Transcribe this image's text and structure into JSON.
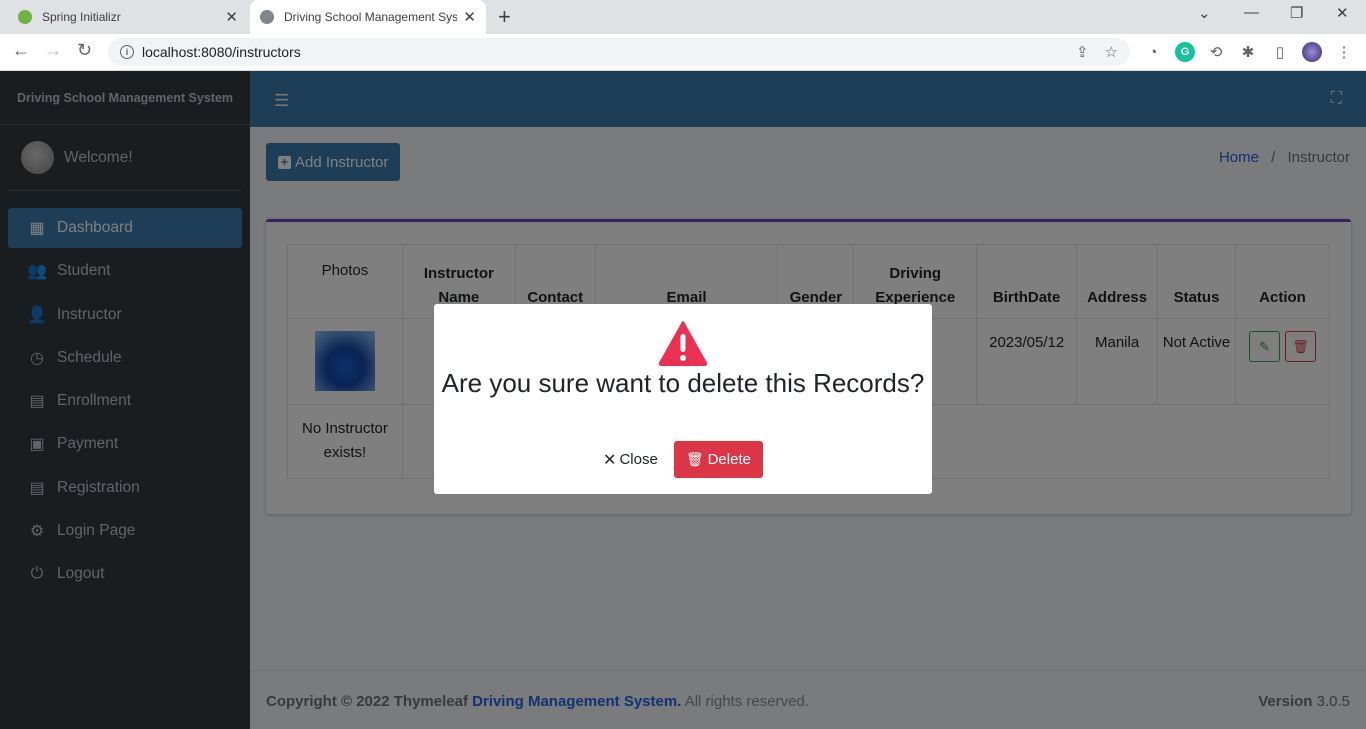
{
  "browser": {
    "tabs": [
      {
        "title": "Spring Initializr",
        "icon": "spring-leaf-icon",
        "color": "#6db33f"
      },
      {
        "title": "Driving School Management Syst",
        "icon": "globe-icon",
        "color": "#5f6368"
      }
    ],
    "url": "localhost:8080/instructors"
  },
  "sidebar": {
    "brand": "Driving School Management System",
    "welcome": "Welcome!",
    "items": [
      {
        "label": "Dashboard",
        "icon": "grid-icon"
      },
      {
        "label": "Student",
        "icon": "users-icon"
      },
      {
        "label": "Instructor",
        "icon": "user-icon"
      },
      {
        "label": "Schedule",
        "icon": "clock-icon"
      },
      {
        "label": "Enrollment",
        "icon": "document-icon"
      },
      {
        "label": "Payment",
        "icon": "money-icon"
      },
      {
        "label": "Registration",
        "icon": "document-icon"
      },
      {
        "label": "Login Page",
        "icon": "user-cog-icon"
      },
      {
        "label": "Logout",
        "icon": "power-icon"
      }
    ]
  },
  "header": {
    "add_button": "Add Instructor",
    "breadcrumb_home": "Home",
    "breadcrumb_sep": "/",
    "breadcrumb_current": "Instructor"
  },
  "table": {
    "columns": [
      "Photos",
      "Instructor Name",
      "Contact",
      "Email",
      "Gender",
      "Driving Experience",
      "BirthDate",
      "Address",
      "Status",
      "Action"
    ],
    "row1": {
      "birthdate": "2023/05/12",
      "address": "Manila",
      "status": "Not Active"
    },
    "empty_message": "No Instructor exists!"
  },
  "footer": {
    "copyright": "Copyright © 2022 Thymeleaf",
    "link": "Driving Management System.",
    "rights": "All rights reserved.",
    "version_label": "Version",
    "version": "3.0.5"
  },
  "modal": {
    "title": "Are you sure want to delete this Records?",
    "close_label": "Close",
    "delete_label": "Delete"
  },
  "colors": {
    "primary": "#3c7aad",
    "sidebar": "#343a40",
    "danger": "#dc3545",
    "success": "#28a745",
    "card_accent": "#6f42c1"
  }
}
